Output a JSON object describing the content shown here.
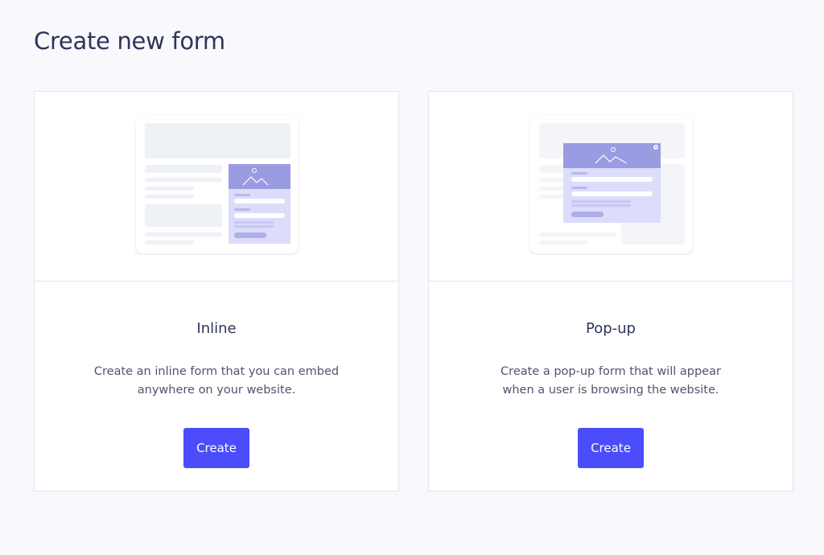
{
  "page": {
    "title": "Create new form"
  },
  "cards": [
    {
      "title": "Inline",
      "description": "Create an inline form that you can embed anywhere on your website.",
      "button_label": "Create",
      "illustration_icon": "inline-form-illustration"
    },
    {
      "title": "Pop-up",
      "description": "Create a pop-up form that will appear when a user is browsing the website.",
      "button_label": "Create",
      "illustration_icon": "popup-form-illustration"
    }
  ],
  "colors": {
    "background": "#f8f8fd",
    "accent": "#4b4dfb",
    "illustration_purple": "#9a9be0",
    "illustration_light": "#dcdcfb"
  }
}
